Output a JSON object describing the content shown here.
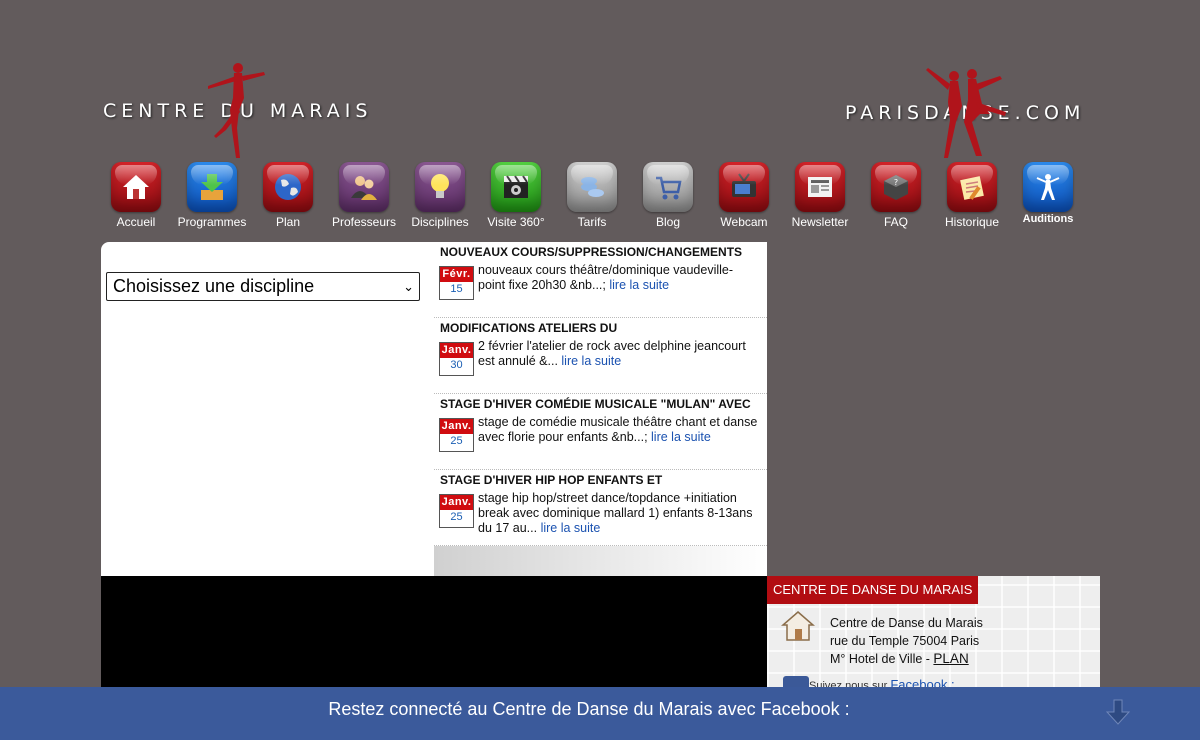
{
  "header": {
    "logo_left": "CENTRE DU MARAIS",
    "logo_right": "PARISDANSE.COM"
  },
  "nav": [
    {
      "label": "Accueil",
      "icon": "home-icon"
    },
    {
      "label": "Programmes",
      "icon": "download-icon"
    },
    {
      "label": "Plan",
      "icon": "globe-icon"
    },
    {
      "label": "Professeurs",
      "icon": "teachers-icon"
    },
    {
      "label": "Disciplines",
      "icon": "lightbulb-icon"
    },
    {
      "label": "Visite 360°",
      "icon": "clapperboard-icon"
    },
    {
      "label": "Tarifs",
      "icon": "coins-icon"
    },
    {
      "label": "Blog",
      "icon": "cart-icon"
    },
    {
      "label": "Webcam",
      "icon": "tv-icon"
    },
    {
      "label": "Newsletter",
      "icon": "newspaper-icon"
    },
    {
      "label": "FAQ",
      "icon": "question-box-icon"
    },
    {
      "label": "Historique",
      "icon": "notepad-icon"
    },
    {
      "label": "Auditions",
      "icon": "dancer-icon"
    }
  ],
  "discipline_select": {
    "value": "Choisissez une discipline"
  },
  "news": [
    {
      "title": "NOUVEAUX COURS/SUPPRESSION/CHANGEMENTS",
      "month": "Févr.",
      "day": "15",
      "text": "  nouveaux cours     théâtre/dominique vaudeville-point fixe 20h30 &nb...;",
      "more": "lire la suite"
    },
    {
      "title": "MODIFICATIONS ATELIERS DU",
      "month": "Janv.",
      "day": "30",
      "text": "  2  février l'atelier de rock avec delphine jeancourt est annulé     &...",
      "more": "lire la suite"
    },
    {
      "title": "STAGE D'HIVER COMÉDIE MUSICALE \"MULAN\" AVEC",
      "month": "Janv.",
      "day": "25",
      "text": " stage de comédie  musicale théâtre chant et danse  avec florie pour enfants &nb...;",
      "more": "lire la suite"
    },
    {
      "title": "STAGE D'HIVER HIP HOP ENFANTS ET",
      "month": "Janv.",
      "day": "25",
      "text": " stage hip hop/street dance/topdance +initiation break avec dominique mallard 1) enfants 8-13ans du 17 au...",
      "more": "lire la suite"
    }
  ],
  "contact": {
    "heading": "CENTRE DE DANSE DU MARAIS",
    "line1": "Centre de Danse du Marais",
    "line2": "rue du Temple 75004 Paris",
    "line3": "M° Hotel de Ville - ",
    "plan_link": "PLAN",
    "follow_text": "Suivez nous sur ",
    "follow_link": "Facebook :"
  },
  "facebook_bar": {
    "text": "Restez connecté au Centre de Danse du Marais avec Facebook :"
  },
  "colors": {
    "background": "#625b5c",
    "accent_red": "#b20d12",
    "facebook_blue": "#3b5a9b",
    "link_blue": "#1b52b0"
  }
}
